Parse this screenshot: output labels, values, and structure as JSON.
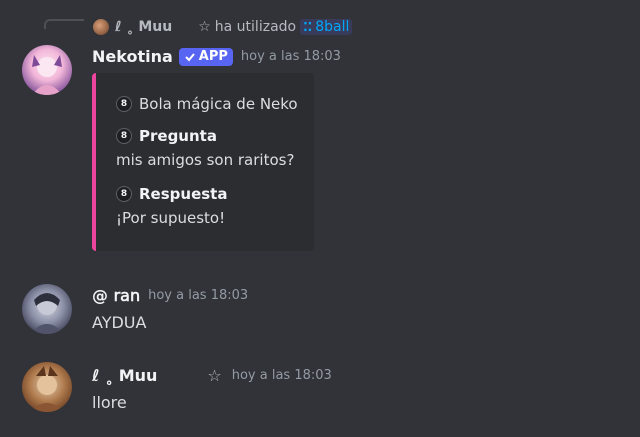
{
  "reply": {
    "username": "ℓ      ˳     Muu",
    "star": "☆",
    "action": "ha utilizado",
    "command_icon": "⁚⁚",
    "command": "8ball"
  },
  "messages": [
    {
      "username": "Nekotina",
      "badge": "APP",
      "timestamp": "hoy a las 18:03",
      "embed": {
        "title_icon": "8",
        "title": "Bola mágica de Neko",
        "fields": [
          {
            "icon": "8",
            "name": "Pregunta",
            "value": "mis amigos son raritos?"
          },
          {
            "icon": "8",
            "name": "Respuesta",
            "value": "¡Por supuesto!"
          }
        ],
        "accent_color": "#eb459e"
      }
    },
    {
      "username": "@ 𝗋𝖺𝗇",
      "timestamp": "hoy a las 18:03",
      "text": "AYDUA"
    },
    {
      "username": "ℓ      ˳     Muu",
      "star": "☆",
      "timestamp": "hoy a las 18:03",
      "text": "llore"
    }
  ],
  "colors": {
    "background": "#313338",
    "embed_background": "#2b2d31",
    "app_badge": "#5865f2",
    "link": "#00a8fc"
  }
}
